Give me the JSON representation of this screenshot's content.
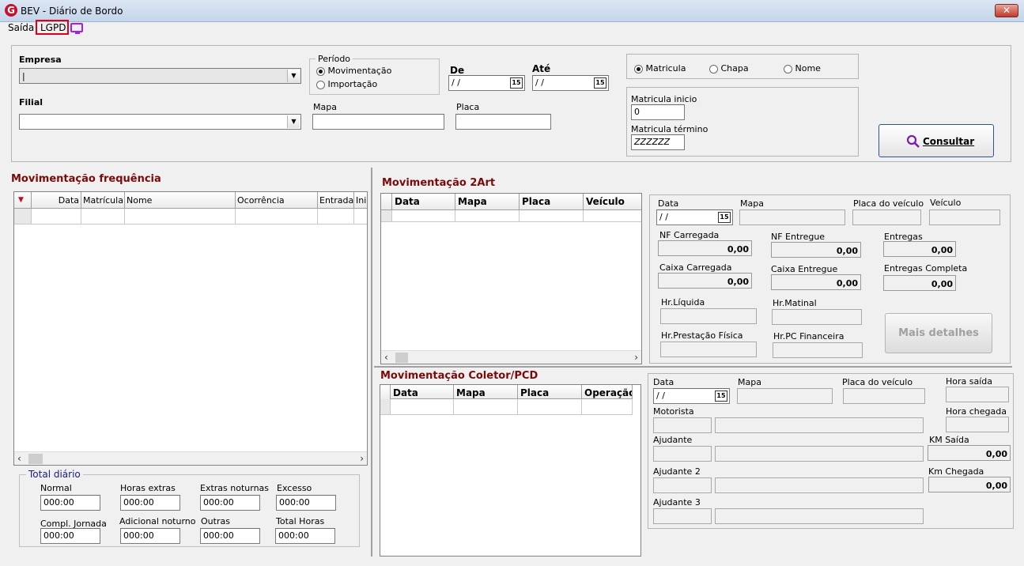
{
  "window": {
    "icon": "G",
    "title": "BEV - Diário de Bordo",
    "close_label": "✕"
  },
  "menu": {
    "saida": "Saída",
    "lgpd": "LGPD"
  },
  "filters": {
    "empresa_label": "Empresa",
    "empresa_value": "|",
    "filial_label": "Filial",
    "filial_value": "",
    "periodo_label": "Período",
    "opt_movimentacao": "Movimentação",
    "opt_importacao": "Importação",
    "de_label": "De",
    "de_value": "/ /",
    "ate_label": "Até",
    "ate_value": "/ /",
    "mapa_label": "Mapa",
    "mapa_value": "",
    "placa_label": "Placa",
    "placa_value": "",
    "opt_matricula": "Matricula",
    "opt_chapa": "Chapa",
    "opt_nome": "Nome",
    "mat_inicio_label": "Matricula inicio",
    "mat_inicio_value": "0",
    "mat_termino_label": "Matricula término",
    "mat_termino_value": "ZZZZZZ",
    "consultar_label": "Consultar",
    "cal_icon_text": "15"
  },
  "freq": {
    "title": "Movimentação frequência",
    "columns": [
      "",
      "Data",
      "Matrícula",
      "Nome",
      "Ocorrência",
      "Entrada",
      "Ini."
    ],
    "total_title": "Total diário",
    "totals": [
      {
        "label": "Normal",
        "value": "000:00"
      },
      {
        "label": "Horas extras",
        "value": "000:00"
      },
      {
        "label": "Extras noturnas",
        "value": "000:00"
      },
      {
        "label": "Excesso",
        "value": "000:00"
      },
      {
        "label": "Compl. Jornada",
        "value": "000:00"
      },
      {
        "label": "Adicional noturno",
        "value": "000:00"
      },
      {
        "label": "Outras",
        "value": "000:00"
      },
      {
        "label": "Total Horas",
        "value": "000:00"
      }
    ]
  },
  "art": {
    "title": "Movimentação 2Art",
    "columns": [
      "Data",
      "Mapa",
      "Placa",
      "Veículo"
    ],
    "data_label": "Data",
    "data_value": "/ /",
    "mapa_label": "Mapa",
    "placa_label": "Placa do veículo",
    "veiculo_label": "Veículo",
    "nf_carregada_label": "NF Carregada",
    "nf_carregada_value": "0,00",
    "nf_entregue_label": "NF Entregue",
    "nf_entregue_value": "0,00",
    "entregas_label": "Entregas",
    "entregas_value": "0,00",
    "caixa_carregada_label": "Caixa Carregada",
    "caixa_carregada_value": "0,00",
    "caixa_entregue_label": "Caixa Entregue",
    "caixa_entregue_value": "0,00",
    "entregas_completa_label": "Entregas Completa",
    "entregas_completa_value": "0,00",
    "hr_liquida_label": "Hr.Líquida",
    "hr_matinal_label": "Hr.Matinal",
    "hr_prestacao_label": "Hr.Prestação Física",
    "hr_pc_label": "Hr.PC Financeira",
    "mais_detalhes_label": "Mais detalhes"
  },
  "coletor": {
    "title": "Movimentação Coletor/PCD",
    "columns": [
      "Data",
      "Mapa",
      "Placa",
      "Operação"
    ],
    "data_label": "Data",
    "data_value": "/ /",
    "mapa_label": "Mapa",
    "placa_label": "Placa do veículo",
    "hora_saida_label": "Hora saída",
    "hora_chegada_label": "Hora chegada",
    "motorista_label": "Motorista",
    "ajudante_label": "Ajudante",
    "ajudante2_label": "Ajudante 2",
    "ajudante3_label": "Ajudante 3",
    "km_saida_label": "KM Saída",
    "km_saida_value": "0,00",
    "km_chegada_label": "Km Chegada",
    "km_chegada_value": "0,00"
  }
}
